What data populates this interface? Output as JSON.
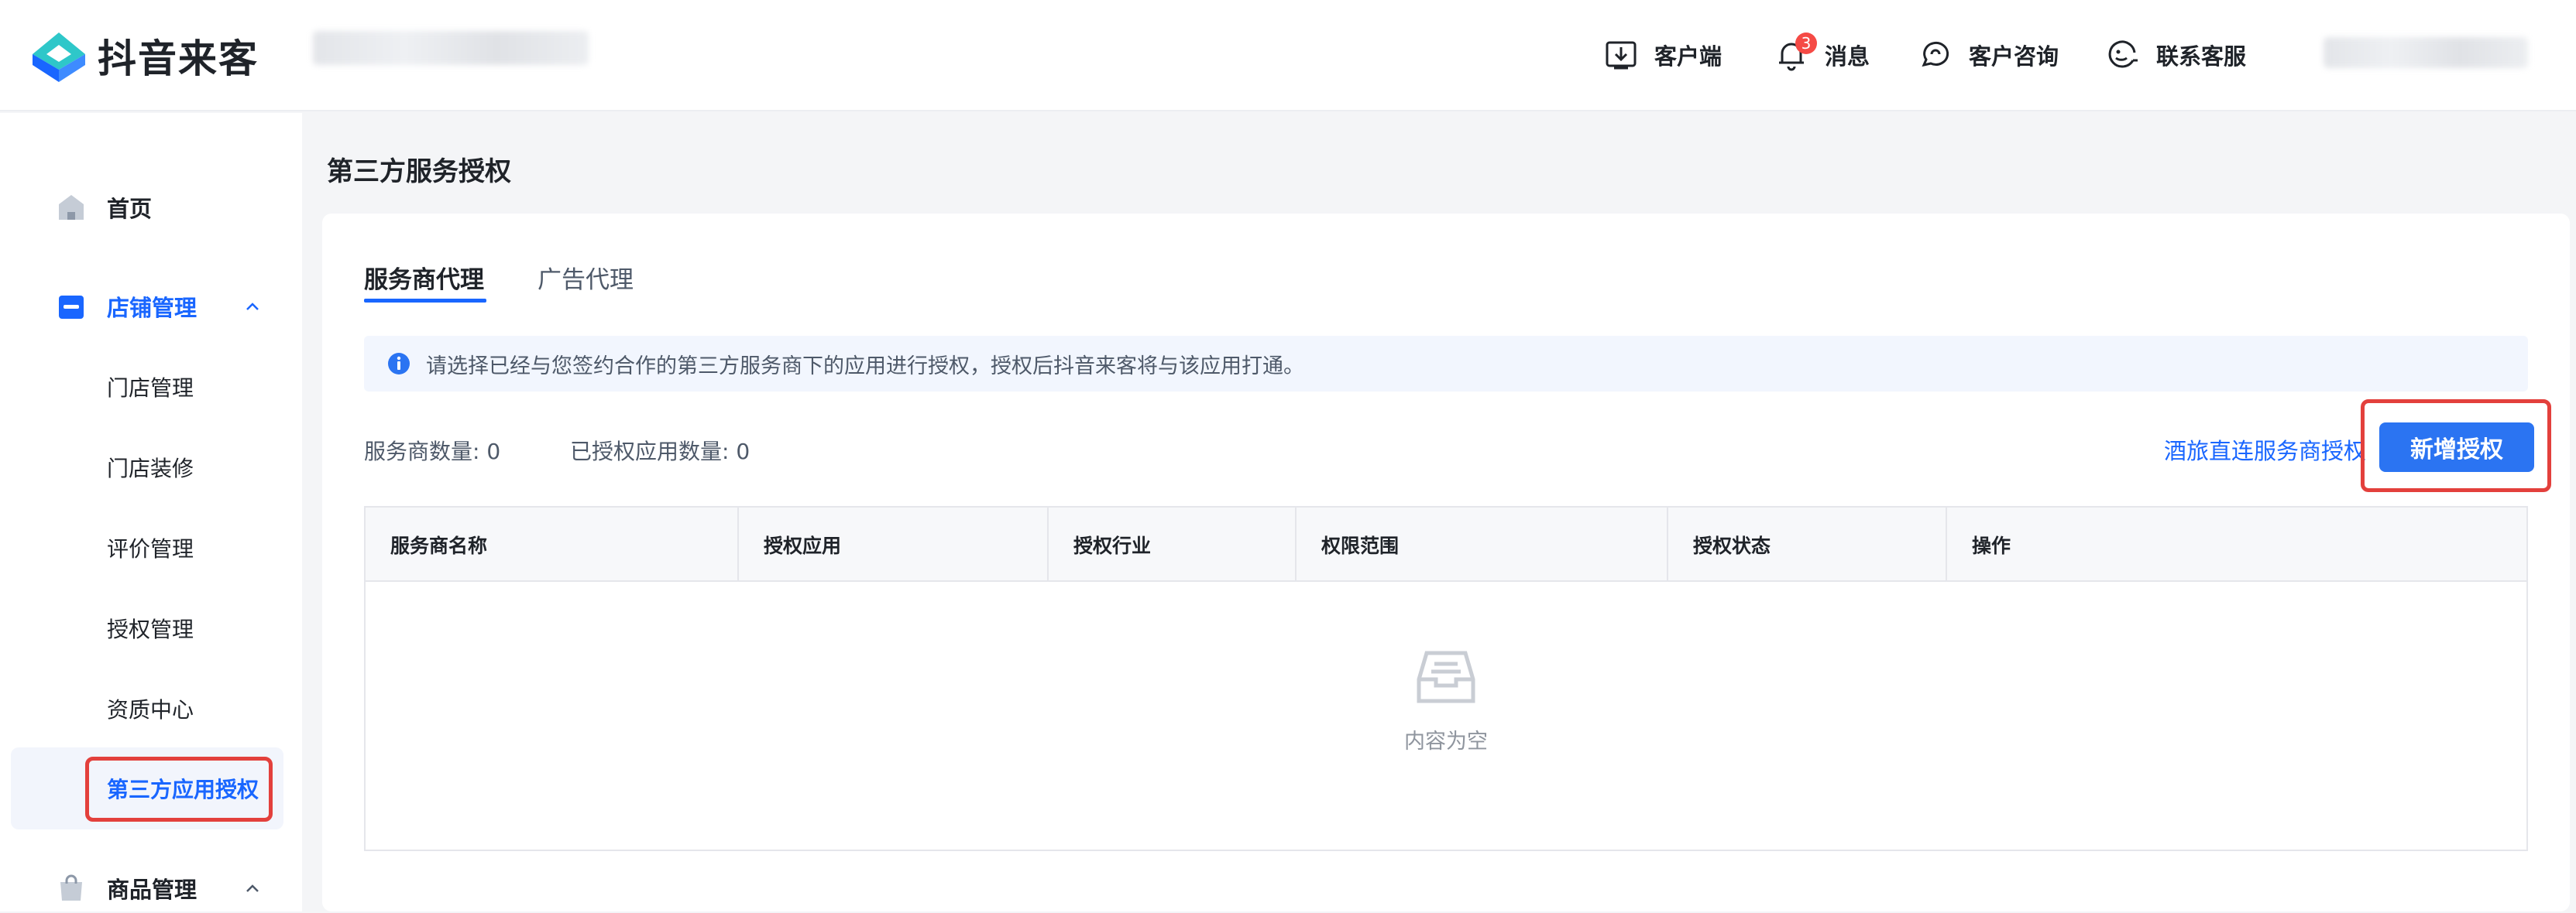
{
  "app": {
    "brand": "抖音来客"
  },
  "header": {
    "items": [
      {
        "label": "客户端",
        "icon": "download-client-icon"
      },
      {
        "label": "消息",
        "icon": "bell-icon",
        "badge": "3"
      },
      {
        "label": "客户咨询",
        "icon": "consult-chat-icon"
      },
      {
        "label": "联系客服",
        "icon": "customer-service-icon"
      }
    ]
  },
  "sidebar": {
    "home": "首页",
    "store_mgmt": "店铺管理",
    "store_items": [
      "门店管理",
      "门店装修",
      "评价管理",
      "授权管理",
      "资质中心",
      "第三方应用授权"
    ],
    "product_mgmt": "商品管理"
  },
  "main": {
    "title": "第三方服务授权",
    "tabs": [
      "服务商代理",
      "广告代理"
    ],
    "active_tab": "服务商代理",
    "notice": "请选择已经与您签约合作的第三方服务商下的应用进行授权，授权后抖音来客将与该应用打通。",
    "stats": {
      "providers": "服务商数量: 0",
      "apps": "已授权应用数量: 0"
    },
    "link": "酒旅直连服务商授权",
    "primary_button": "新增授权",
    "table": {
      "headers": [
        "服务商名称",
        "授权应用",
        "授权行业",
        "权限范围",
        "授权状态",
        "操作"
      ],
      "rows": [],
      "empty_text": "内容为空"
    }
  },
  "colors": {
    "accent": "#1966ff",
    "button": "#2b74f2",
    "highlight": "#e3403c",
    "badge": "#f54a45"
  }
}
